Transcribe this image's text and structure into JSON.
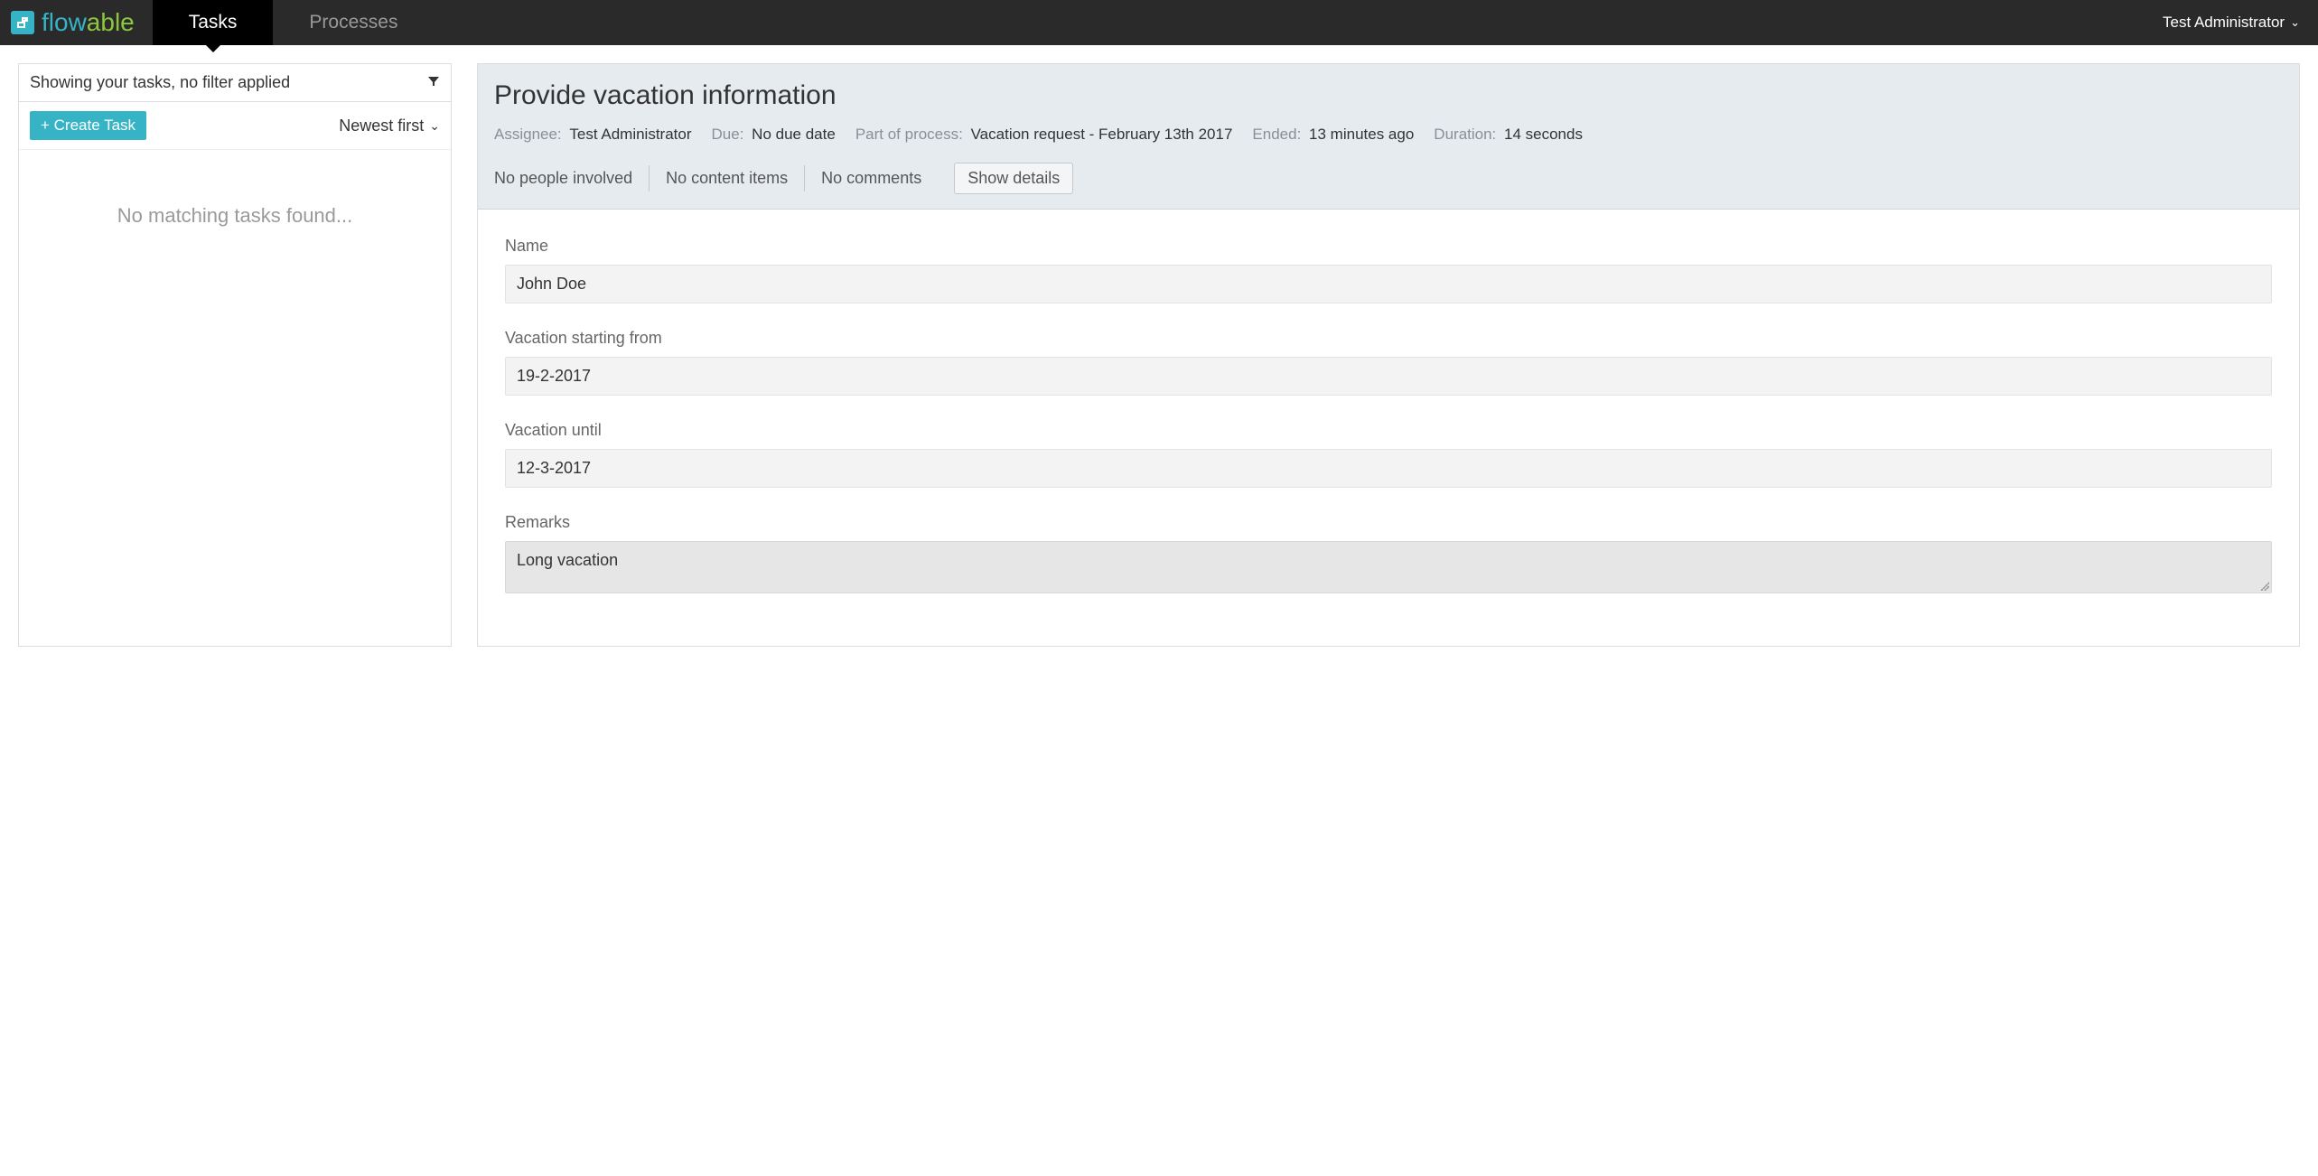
{
  "nav": {
    "tabs": [
      "Tasks",
      "Processes"
    ],
    "active_tab": "Tasks",
    "user": "Test Administrator"
  },
  "left": {
    "filter_text": "Showing your tasks, no filter applied",
    "create_btn": "+ Create Task",
    "sort_label": "Newest first",
    "empty_msg": "No matching tasks found..."
  },
  "task": {
    "title": "Provide vacation information",
    "meta": {
      "assignee_label": "Assignee:",
      "assignee_value": "Test Administrator",
      "due_label": "Due:",
      "due_value": "No due date",
      "process_label": "Part of process:",
      "process_value": "Vacation request - February 13th 2017",
      "ended_label": "Ended:",
      "ended_value": "13 minutes ago",
      "duration_label": "Duration:",
      "duration_value": "14 seconds"
    },
    "info": {
      "people": "No people involved",
      "content": "No content items",
      "comments": "No comments",
      "show_details": "Show details"
    },
    "form": {
      "name_label": "Name",
      "name_value": "John Doe",
      "start_label": "Vacation starting from",
      "start_value": "19-2-2017",
      "until_label": "Vacation until",
      "until_value": "12-3-2017",
      "remarks_label": "Remarks",
      "remarks_value": "Long vacation"
    }
  }
}
